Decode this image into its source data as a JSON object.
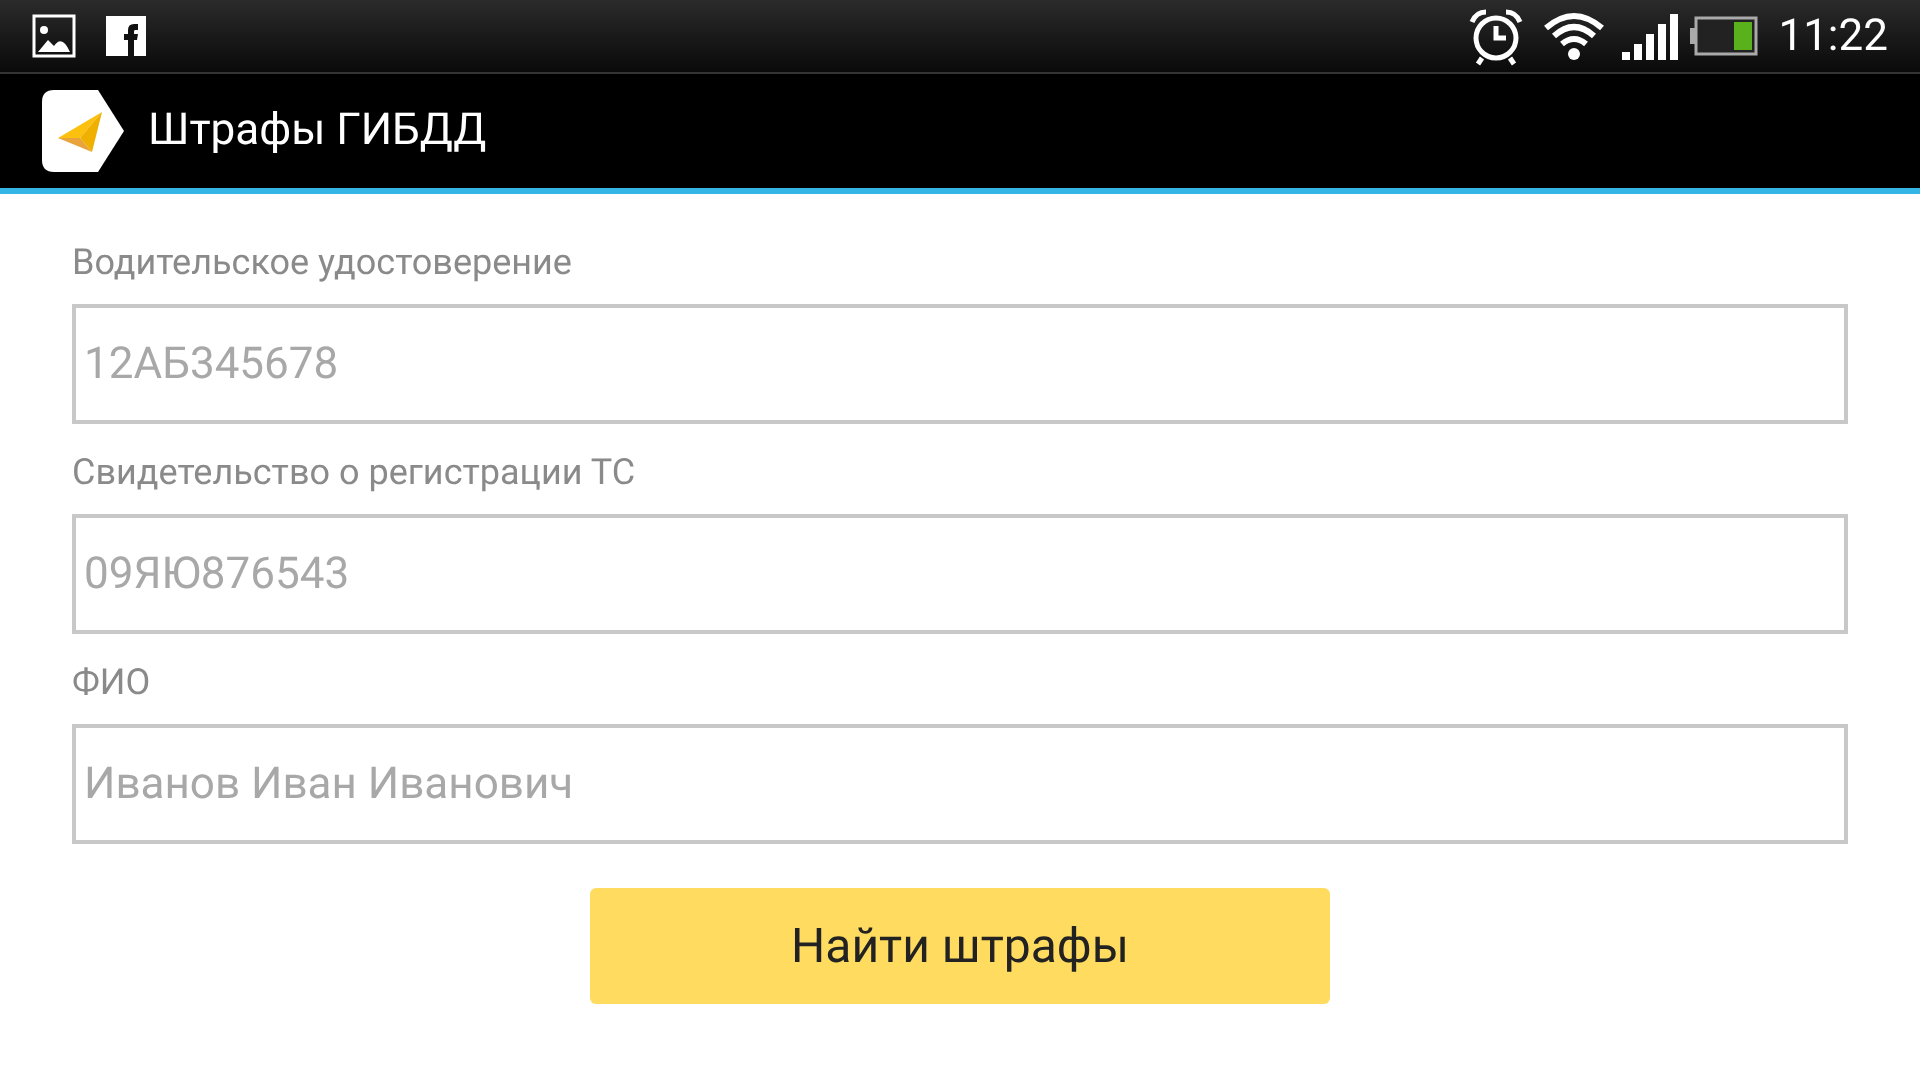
{
  "status_bar": {
    "time": "11:22"
  },
  "action_bar": {
    "title": "Штрафы ГИБДД"
  },
  "fields": [
    {
      "label": "Водительское удостоверение",
      "placeholder": "12АБ345678"
    },
    {
      "label": "Свидетельство о регистрации ТС",
      "placeholder": "09ЯЮ876543"
    },
    {
      "label": "ФИО",
      "placeholder": "Иванов Иван Иванович"
    }
  ],
  "submit_button": {
    "label": "Найти штрафы"
  }
}
